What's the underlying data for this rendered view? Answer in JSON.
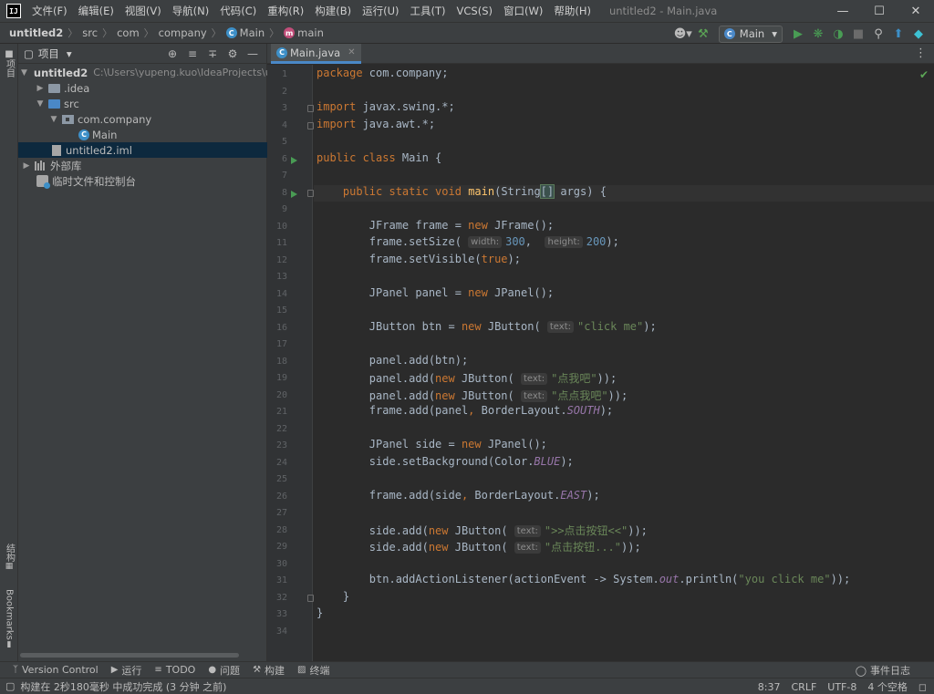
{
  "menubar": {
    "logo": "IJ",
    "items": [
      "文件(F)",
      "编辑(E)",
      "视图(V)",
      "导航(N)",
      "代码(C)",
      "重构(R)",
      "构建(B)",
      "运行(U)",
      "工具(T)",
      "VCS(S)",
      "窗口(W)",
      "帮助(H)"
    ],
    "title": "untitled2 - Main.java"
  },
  "navbar": {
    "crumbs": [
      "untitled2",
      "src",
      "com",
      "company",
      "Main",
      "main"
    ],
    "run_config": "Main"
  },
  "left_stripe": {
    "project": "项目",
    "structure": "结构",
    "bookmarks": "Bookmarks"
  },
  "project_panel": {
    "title": "项目",
    "root": "untitled2",
    "root_path": "C:\\Users\\yupeng.kuo\\IdeaProjects\\un",
    "idea": ".idea",
    "src": "src",
    "package": "com.company",
    "main": "Main",
    "iml": "untitled2.iml",
    "libs": "外部库",
    "scratches": "临时文件和控制台"
  },
  "editor": {
    "tab": "Main.java",
    "line_numbers": [
      "1",
      "2",
      "3",
      "4",
      "5",
      "6",
      "7",
      "8",
      "9",
      "10",
      "11",
      "12",
      "13",
      "14",
      "15",
      "16",
      "17",
      "18",
      "19",
      "20",
      "21",
      "22",
      "23",
      "24",
      "25",
      "26",
      "27",
      "28",
      "29",
      "30",
      "31",
      "32",
      "33",
      "34"
    ],
    "hints": {
      "width": "width:",
      "height": "height:",
      "text": "text:"
    },
    "strings": {
      "click_me": "\"click me\"",
      "s1": "\"点我吧\"",
      "s2": "\"点点我吧\"",
      "s3": "\">>点击按钮<<\"",
      "s4": "\"点击按钮...\"",
      "you_click_me": "\"you click me\""
    },
    "numbers": {
      "w": "300",
      "h": "200"
    }
  },
  "bottom_bar": {
    "items": [
      "Version Control",
      "运行",
      "TODO",
      "问题",
      "构建",
      "终端"
    ],
    "event_log": "事件日志"
  },
  "status_bar": {
    "message": "构建在 2秒180毫秒 中成功完成 (3 分钟 之前)",
    "position": "8:37",
    "line_sep": "CRLF",
    "encoding": "UTF-8",
    "indent": "4 个空格"
  }
}
